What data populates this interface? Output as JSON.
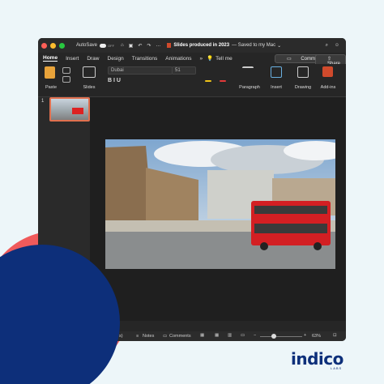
{
  "titlebar": {
    "autosave_label": "AutoSave",
    "autosave_state": "OFF",
    "title": "Slides produced in 2023",
    "saved_status": "— Saved to my Mac",
    "chevron": "⌄"
  },
  "tabs": [
    "Home",
    "Insert",
    "Draw",
    "Design",
    "Transitions",
    "Animations"
  ],
  "tabs_more": "»",
  "tell_me": "Tell me",
  "comments_label": "Comments",
  "share_label": "Share",
  "ribbon": {
    "paste": "Paste",
    "slides": "Slides",
    "font_name": "Dubai",
    "font_size": "51",
    "paragraph": "Paragraph",
    "insert": "Insert",
    "drawing": "Drawing",
    "addins": "Add-ins"
  },
  "slide_number": "1",
  "notes_label": "notes",
  "status": {
    "notes": "Notes",
    "comments": "Comments",
    "zoom": "63%",
    "left_text": "s)"
  },
  "brand": {
    "logo_text": "indico",
    "logo_sub": "LABS"
  },
  "colors": {
    "background": "#edf6f9",
    "navy": "#0d2f7a",
    "coral": "#f05a5b",
    "accent_orange": "#f0883e"
  }
}
